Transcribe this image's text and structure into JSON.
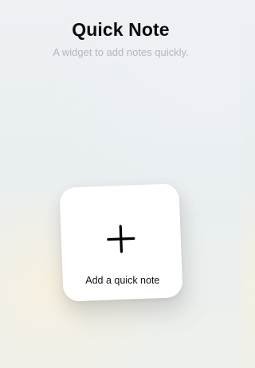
{
  "header": {
    "title": "Quick Note",
    "subtitle": "A widget to add notes quickly."
  },
  "widget": {
    "icon": "plus-icon",
    "label": "Add a quick note"
  },
  "colors": {
    "title": "#0b0b0b",
    "subtitle": "#b3b6bb",
    "widget_background": "#ffffff"
  }
}
